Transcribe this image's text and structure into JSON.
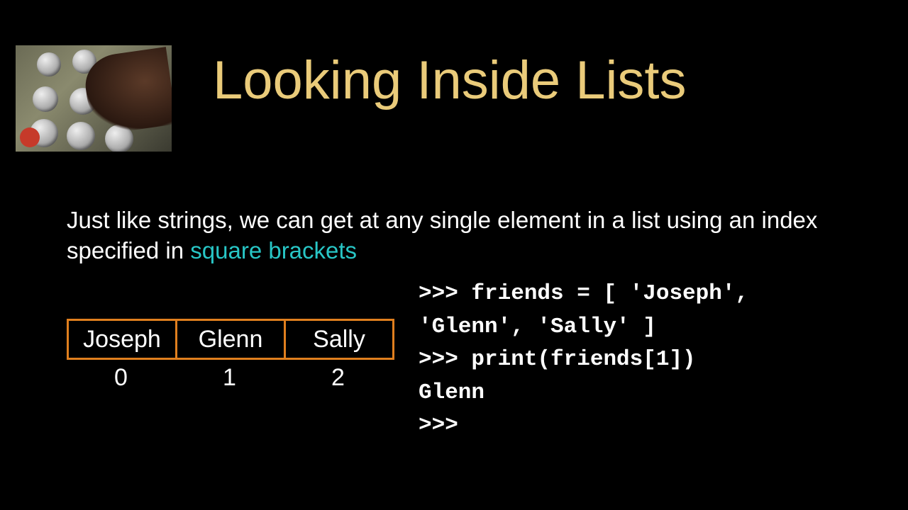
{
  "title": "Looking Inside Lists",
  "body": {
    "prefix": "Just like strings, we can get at any single element in a list using an index specified in ",
    "highlight": "square brackets"
  },
  "diagram": {
    "cells": [
      "Joseph",
      "Glenn",
      "Sally"
    ],
    "indices": [
      "0",
      "1",
      "2"
    ]
  },
  "code": {
    "l1": ">>> friends = [ 'Joseph',",
    "l2": "'Glenn', 'Sally' ]",
    "l3": ">>> print(friends[1])",
    "l4": "Glenn",
    "l5": ">>>"
  }
}
